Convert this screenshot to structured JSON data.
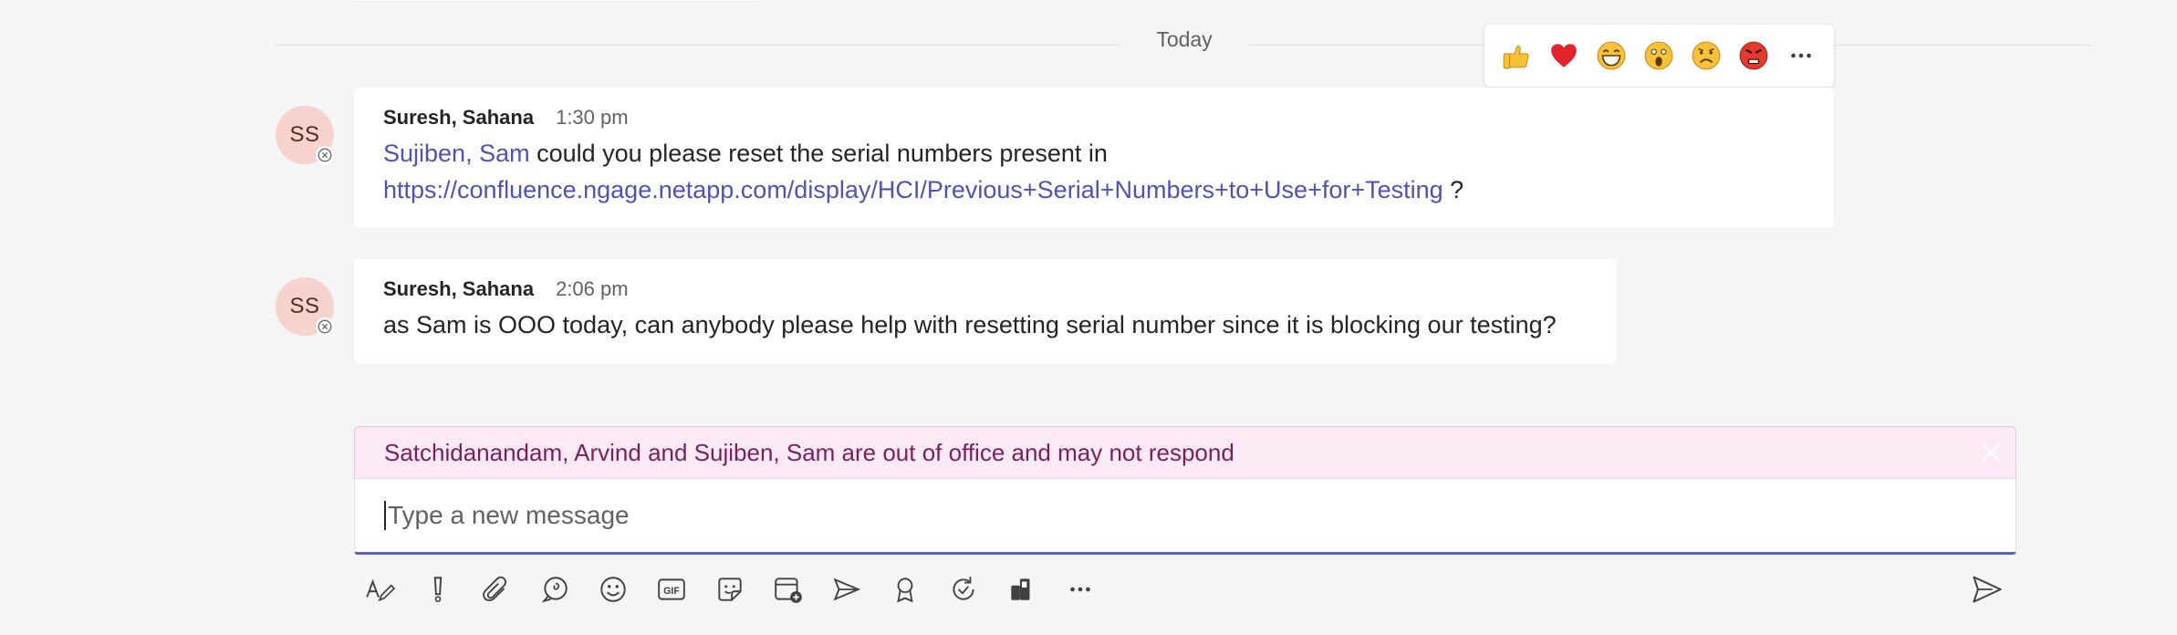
{
  "divider": {
    "label": "Today"
  },
  "reactions": [
    {
      "name": "like",
      "icon": "thumbs-up-icon"
    },
    {
      "name": "heart",
      "icon": "heart-icon"
    },
    {
      "name": "laugh",
      "icon": "laughing-face-icon"
    },
    {
      "name": "surprised",
      "icon": "surprised-face-icon"
    },
    {
      "name": "sad",
      "icon": "sad-face-icon"
    },
    {
      "name": "angry",
      "icon": "angry-face-icon"
    },
    {
      "name": "more",
      "icon": "more-icon"
    }
  ],
  "messages": [
    {
      "initials": "SS",
      "author": "Suresh, Sahana",
      "time": "1:30 pm",
      "mentions": "Sujiben, Sam",
      "text_after_mention": " could you please reset the serial numbers present in",
      "link": "https://confluence.ngage.netapp.com/display/HCI/Previous+Serial+Numbers+to+Use+for+Testing",
      "text_after_link": " ?"
    },
    {
      "initials": "SS",
      "author": "Suresh, Sahana",
      "time": "2:06 pm",
      "text": "as Sam is OOO today, can anybody please help with resetting serial number since it is blocking our testing?"
    }
  ],
  "ooo_banner": {
    "text": "Satchidanandam, Arvind and Sujiben, Sam are out of office and may not respond"
  },
  "compose": {
    "placeholder": "Type a new message",
    "value": ""
  },
  "toolbar": [
    "format-icon",
    "important-icon",
    "attach-icon",
    "loop-icon",
    "emoji-icon",
    "gif-icon",
    "sticker-icon",
    "schedule-meeting-icon",
    "stream-icon",
    "praise-icon",
    "updates-icon",
    "apps-icon",
    "more-options-icon"
  ],
  "colors": {
    "accent": "#5b5fc7",
    "link": "#4f52b2",
    "avatar_bg": "#f6d4cd",
    "banner_bg": "#fbeaf5",
    "banner_text": "#7b1f5c"
  }
}
